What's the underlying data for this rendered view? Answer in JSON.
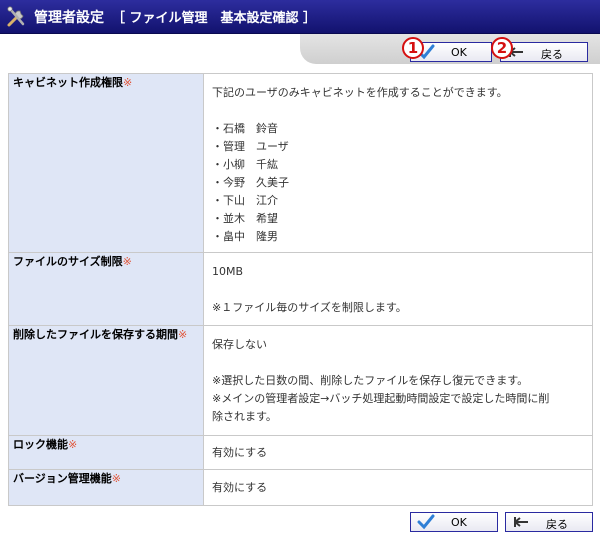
{
  "header": {
    "title": "管理者設定",
    "subtitle": "［ ファイル管理　基本設定確認 ］"
  },
  "buttons": {
    "ok_label": "OK",
    "back_label": "戻る"
  },
  "markers": [
    "1",
    "2"
  ],
  "rows": [
    {
      "label": "キャビネット作成権限",
      "required_mark": "※",
      "lines": [
        "下記のユーザのみキャビネットを作成することができます。",
        "",
        "・石橋　鈴音",
        "・管理　ユーザ",
        "・小柳　千紘",
        "・今野　久美子",
        "・下山　江介",
        "・並木　希望",
        "・畠中　隆男"
      ]
    },
    {
      "label": "ファイルのサイズ制限",
      "required_mark": "※",
      "lines": [
        "10MB",
        "",
        "※１ファイル毎のサイズを制限します。"
      ]
    },
    {
      "label": "削除したファイルを保存する期間",
      "required_mark": "※",
      "lines": [
        "保存しない",
        "",
        "※選択した日数の間、削除したファイルを保存し復元できます。",
        "※メインの管理者設定→バッチ処理起動時間設定で設定した時間に削",
        "除されます。"
      ]
    },
    {
      "label": "ロック機能",
      "required_mark": "※",
      "lines": [
        "有効にする"
      ]
    },
    {
      "label": "バージョン管理機能",
      "required_mark": "※",
      "lines": [
        "有効にする"
      ]
    }
  ]
}
